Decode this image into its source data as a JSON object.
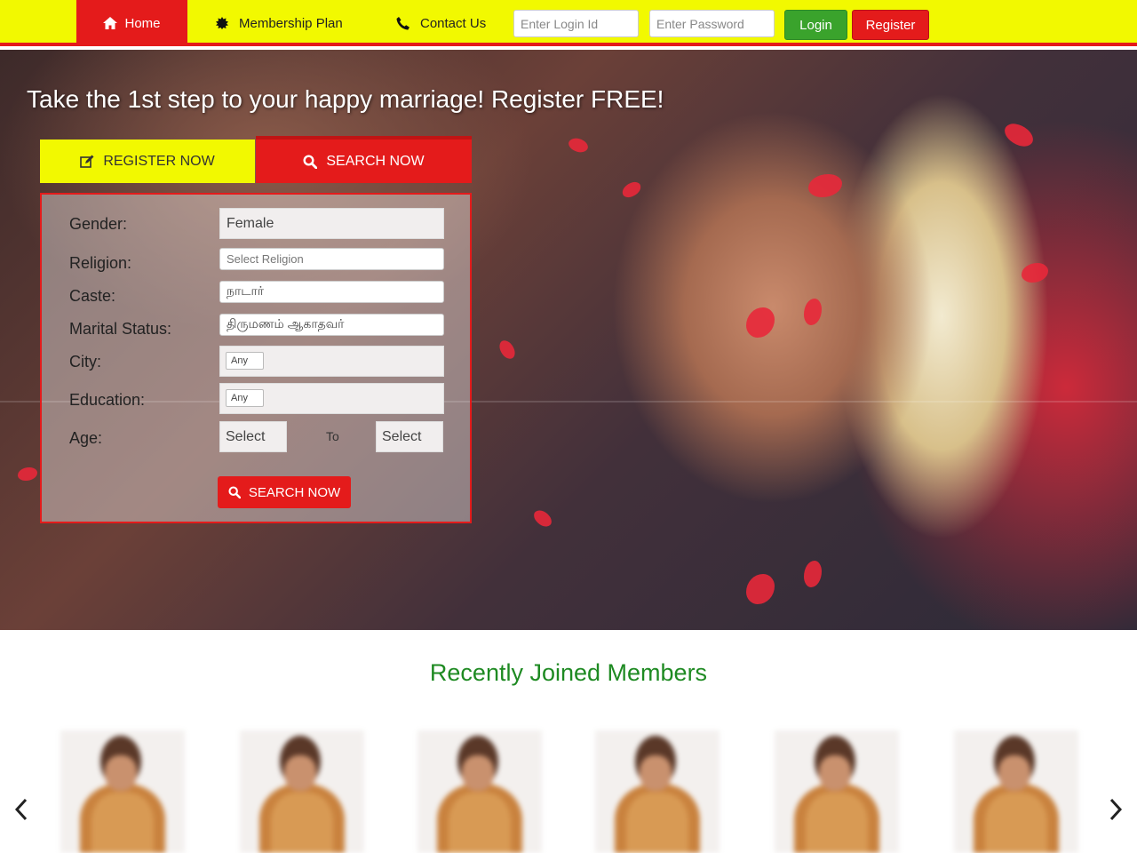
{
  "nav": {
    "home_label": "Home",
    "membership_label": "Membership Plan",
    "contact_label": "Contact Us",
    "login_placeholder": "Enter Login Id",
    "password_placeholder": "Enter Password",
    "login_button": "Login",
    "register_button": "Register",
    "home_icon": "home-icon",
    "membership_icon": "certificate-icon",
    "contact_icon": "phone-icon"
  },
  "hero": {
    "title": "Take the 1st step to your happy marriage! Register FREE!",
    "tab_register": "REGISTER NOW",
    "tab_search": "SEARCH NOW",
    "tab_register_icon": "edit-icon",
    "tab_search_icon": "search-icon"
  },
  "search_form": {
    "gender_label": "Gender:",
    "gender_value": "Female",
    "religion_label": "Religion:",
    "religion_value": "Select Religion",
    "caste_label": "Caste:",
    "caste_value": "நாடார்",
    "marital_label": "Marital Status:",
    "marital_value": "திருமணம் ஆகாதவர்",
    "city_label": "City:",
    "city_value": "Any",
    "education_label": "Education:",
    "education_value": "Any",
    "age_label": "Age:",
    "age_from": "Select",
    "age_to_label": "To",
    "age_to": "Select",
    "search_button": "SEARCH NOW"
  },
  "recent": {
    "title": "Recently Joined Members",
    "prev_icon": "chevron-left-icon",
    "next_icon": "chevron-right-icon"
  },
  "colors": {
    "nav_bg": "#f2f900",
    "accent_red": "#e41b1b",
    "login_green": "#3aa32c",
    "heading_green": "#1e8a22"
  }
}
